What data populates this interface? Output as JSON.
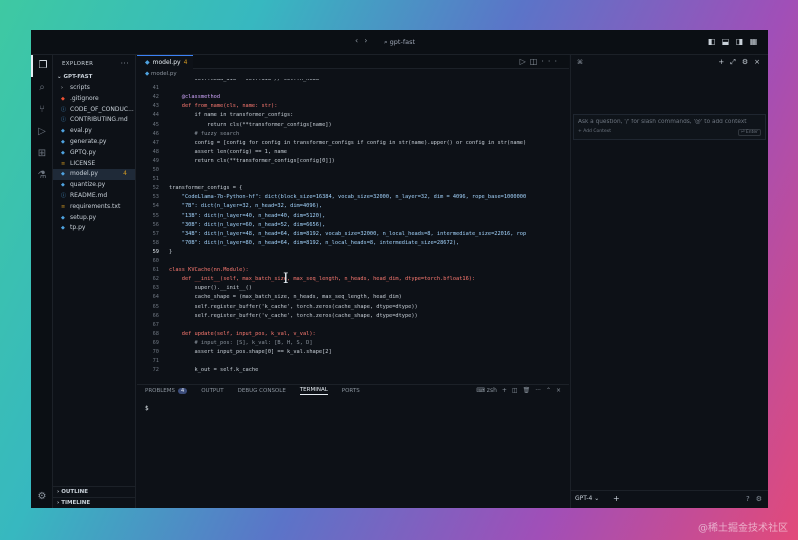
{
  "window": {
    "title": "gpt-fast"
  },
  "sidebar": {
    "header": "EXPLORER",
    "folder": "GPT-FAST",
    "items": [
      {
        "label": "scripts",
        "type": "folder"
      },
      {
        "label": ".gitignore",
        "type": "git"
      },
      {
        "label": "CODE_OF_CONDUC...",
        "type": "md"
      },
      {
        "label": "CONTRIBUTING.md",
        "type": "md"
      },
      {
        "label": "eval.py",
        "type": "py"
      },
      {
        "label": "generate.py",
        "type": "py"
      },
      {
        "label": "GPTQ.py",
        "type": "py"
      },
      {
        "label": "LICENSE",
        "type": "txt"
      },
      {
        "label": "model.py",
        "type": "py",
        "modified": "4",
        "selected": true
      },
      {
        "label": "quantize.py",
        "type": "py"
      },
      {
        "label": "README.md",
        "type": "md"
      },
      {
        "label": "requirements.txt",
        "type": "txt"
      },
      {
        "label": "setup.py",
        "type": "py"
      },
      {
        "label": "tp.py",
        "type": "py"
      }
    ],
    "outline": "OUTLINE",
    "timeline": "TIMELINE"
  },
  "editor": {
    "tab": {
      "label": "model.py",
      "modified": "4"
    },
    "breadcrumb": "model.py",
    "current_line": "59",
    "lines": [
      {
        "n": "",
        "t": "        self.head_dim = self.dim // self.n_head"
      },
      {
        "n": "41",
        "t": ""
      },
      {
        "n": "42",
        "t": "    @classmethod"
      },
      {
        "n": "43",
        "t": "    def from_name(cls, name: str):"
      },
      {
        "n": "44",
        "t": "        if name in transformer_configs:"
      },
      {
        "n": "45",
        "t": "            return cls(**transformer_configs[name])"
      },
      {
        "n": "46",
        "t": "        # fuzzy search"
      },
      {
        "n": "47",
        "t": "        config = [config for config in transformer_configs if config in str(name).upper() or config in str(name)"
      },
      {
        "n": "48",
        "t": "        assert len(config) == 1, name"
      },
      {
        "n": "49",
        "t": "        return cls(**transformer_configs[config[0]])"
      },
      {
        "n": "50",
        "t": ""
      },
      {
        "n": "51",
        "t": ""
      },
      {
        "n": "52",
        "t": "transformer_configs = {"
      },
      {
        "n": "53",
        "t": "    \"CodeLlama-7b-Python-hf\": dict(block_size=16384, vocab_size=32000, n_layer=32, dim = 4096, rope_base=1000000"
      },
      {
        "n": "54",
        "t": "    \"7B\": dict(n_layer=32, n_head=32, dim=4096),"
      },
      {
        "n": "55",
        "t": "    \"13B\": dict(n_layer=40, n_head=40, dim=5120),"
      },
      {
        "n": "56",
        "t": "    \"30B\": dict(n_layer=60, n_head=52, dim=6656),"
      },
      {
        "n": "57",
        "t": "    \"34B\": dict(n_layer=48, n_head=64, dim=8192, vocab_size=32000, n_local_heads=8, intermediate_size=22016, rop"
      },
      {
        "n": "58",
        "t": "    \"70B\": dict(n_layer=80, n_head=64, dim=8192, n_local_heads=8, intermediate_size=28672),"
      },
      {
        "n": "59",
        "t": "}"
      },
      {
        "n": "60",
        "t": ""
      },
      {
        "n": "61",
        "t": "class KVCache(nn.Module):"
      },
      {
        "n": "62",
        "t": "    def __init__(self, max_batch_size, max_seq_length, n_heads, head_dim, dtype=torch.bfloat16):"
      },
      {
        "n": "63",
        "t": "        super().__init__()"
      },
      {
        "n": "64",
        "t": "        cache_shape = (max_batch_size, n_heads, max_seq_length, head_dim)"
      },
      {
        "n": "65",
        "t": "        self.register_buffer('k_cache', torch.zeros(cache_shape, dtype=dtype))"
      },
      {
        "n": "66",
        "t": "        self.register_buffer('v_cache', torch.zeros(cache_shape, dtype=dtype))"
      },
      {
        "n": "67",
        "t": ""
      },
      {
        "n": "68",
        "t": "    def update(self, input_pos, k_val, v_val):"
      },
      {
        "n": "69",
        "t": "        # input_pos: [S], k_val: [B, H, S, D]"
      },
      {
        "n": "70",
        "t": "        assert input_pos.shape[0] == k_val.shape[2]"
      },
      {
        "n": "71",
        "t": ""
      },
      {
        "n": "72",
        "t": "        k_out = self.k_cache"
      }
    ]
  },
  "panel": {
    "tabs": [
      "PROBLEMS",
      "OUTPUT",
      "DEBUG CONSOLE",
      "TERMINAL",
      "PORTS"
    ],
    "problems_count": "4",
    "active": "TERMINAL",
    "shell": "zsh",
    "prompt": "$"
  },
  "chat": {
    "placeholder": "Ask a question, '/' for slash commands, '@' to add context",
    "add_context": "+ Add Context",
    "enter_hint": "⏎ Enter",
    "model": "GPT-4"
  },
  "watermark": "@稀土掘金技术社区",
  "colors": {
    "accent": "#3b82f6",
    "modified": "#d29922",
    "keyword": "#ff7b72",
    "string": "#a5d6ff",
    "function": "#d2a8ff",
    "comment": "#8b949e"
  }
}
